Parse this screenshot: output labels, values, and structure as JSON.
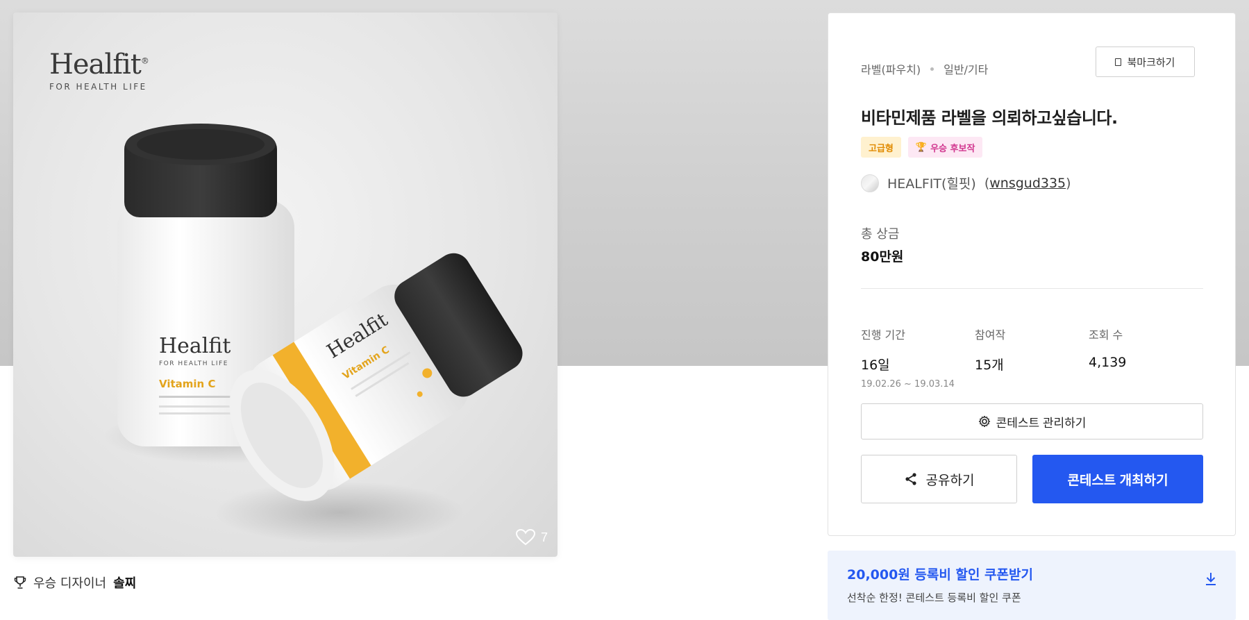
{
  "image": {
    "brand_logo_text": "Healfit",
    "brand_logo_mark": "®",
    "brand_logo_tagline": "FOR HEALTH LIFE",
    "likes_count": "7",
    "heart_icon": "heart-outline-icon"
  },
  "winner": {
    "prefix": "우승 디자이너",
    "designer_name": "솔찌",
    "trophy_icon": "trophy-icon"
  },
  "panel": {
    "category_main": "라벨(파우치)",
    "category_sub": "일반/기타",
    "bookmark_label": "북마크하기",
    "title": "비타민제품 라벨을 의뢰하고싶습니다.",
    "badge_premium": "고급형",
    "badge_winner": "우승 후보작",
    "owner_name": "HEALFIT(힐핏)",
    "owner_id_open": "(",
    "owner_id": "wnsgud335",
    "owner_id_close": ")",
    "prize_label": "총 상금",
    "prize_value": "80만원",
    "stats": [
      {
        "label": "진행 기간",
        "value": "16일",
        "sub": "19.02.26 ~ 19.03.14"
      },
      {
        "label": "참여작",
        "value": "15개"
      },
      {
        "label": "조회 수",
        "value": "4,139"
      }
    ],
    "manage_label": "콘테스트 관리하기",
    "share_label": "공유하기",
    "host_label": "콘테스트 개최하기"
  },
  "coupon": {
    "title": "20,000원 등록비 할인 쿠폰받기",
    "subtitle": "선착순 한정! 콘테스트 등록비 할인 쿠폰"
  },
  "colors": {
    "primary": "#2458f0",
    "premium_badge_text": "#e08a00",
    "winner_badge_text": "#d1378f",
    "coupon_bg": "#eef3fd"
  }
}
